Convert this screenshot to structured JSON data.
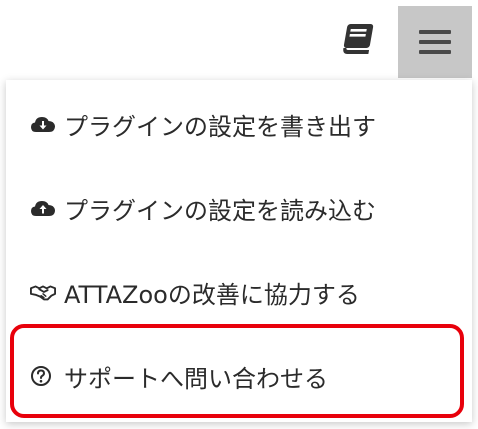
{
  "toolbar": {
    "book_icon": "book-icon",
    "menu_icon": "hamburger-menu-icon",
    "menu_active_bg": "#c7c7c7"
  },
  "menu": {
    "items": [
      {
        "icon": "cloud-download-icon",
        "label": "プラグインの設定を書き出す"
      },
      {
        "icon": "cloud-upload-icon",
        "label": "プラグインの設定を読み込む"
      },
      {
        "icon": "handshake-icon",
        "label": "ATTAZooの改善に協力する"
      },
      {
        "icon": "question-circle-icon",
        "label": "サポートへ問い合わせる"
      }
    ]
  },
  "highlight_color": "#e8000b"
}
